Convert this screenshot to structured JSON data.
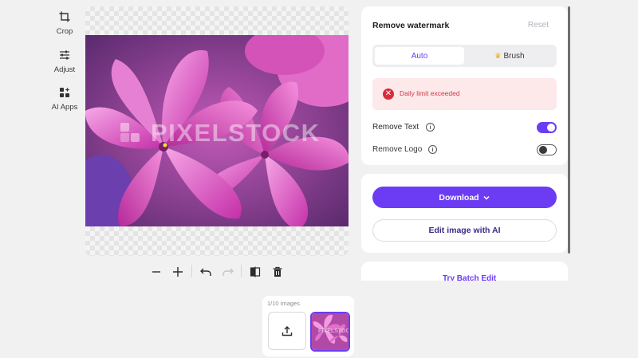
{
  "tools": [
    {
      "label": "Crop",
      "icon": "crop-icon"
    },
    {
      "label": "Adjust",
      "icon": "sliders-icon"
    },
    {
      "label": "AI Apps",
      "icon": "apps-icon"
    }
  ],
  "canvas": {
    "watermark_text": "PIXELSTOCK"
  },
  "toolbar": {
    "icons": [
      "zoom-out-icon",
      "zoom-in-icon",
      "undo-icon",
      "redo-icon",
      "compare-icon",
      "delete-icon"
    ]
  },
  "strip": {
    "count": "1/10 images"
  },
  "panel": {
    "title": "Remove watermark",
    "reset": "Reset",
    "modes": {
      "auto": "Auto",
      "brush": "Brush",
      "selected": "Auto"
    },
    "alert": "Daily limit exceeded",
    "remove_text": {
      "label": "Remove Text",
      "enabled": true
    },
    "remove_logo": {
      "label": "Remove Logo",
      "enabled": false
    },
    "download": "Download",
    "edit_ai": "Edit image with AI",
    "batch": "Try Batch Edit"
  },
  "colors": {
    "accent": "#6c3cf5",
    "alert_bg": "#fde8ea",
    "alert_text": "#d23a48",
    "flower": "#e25bc7"
  }
}
